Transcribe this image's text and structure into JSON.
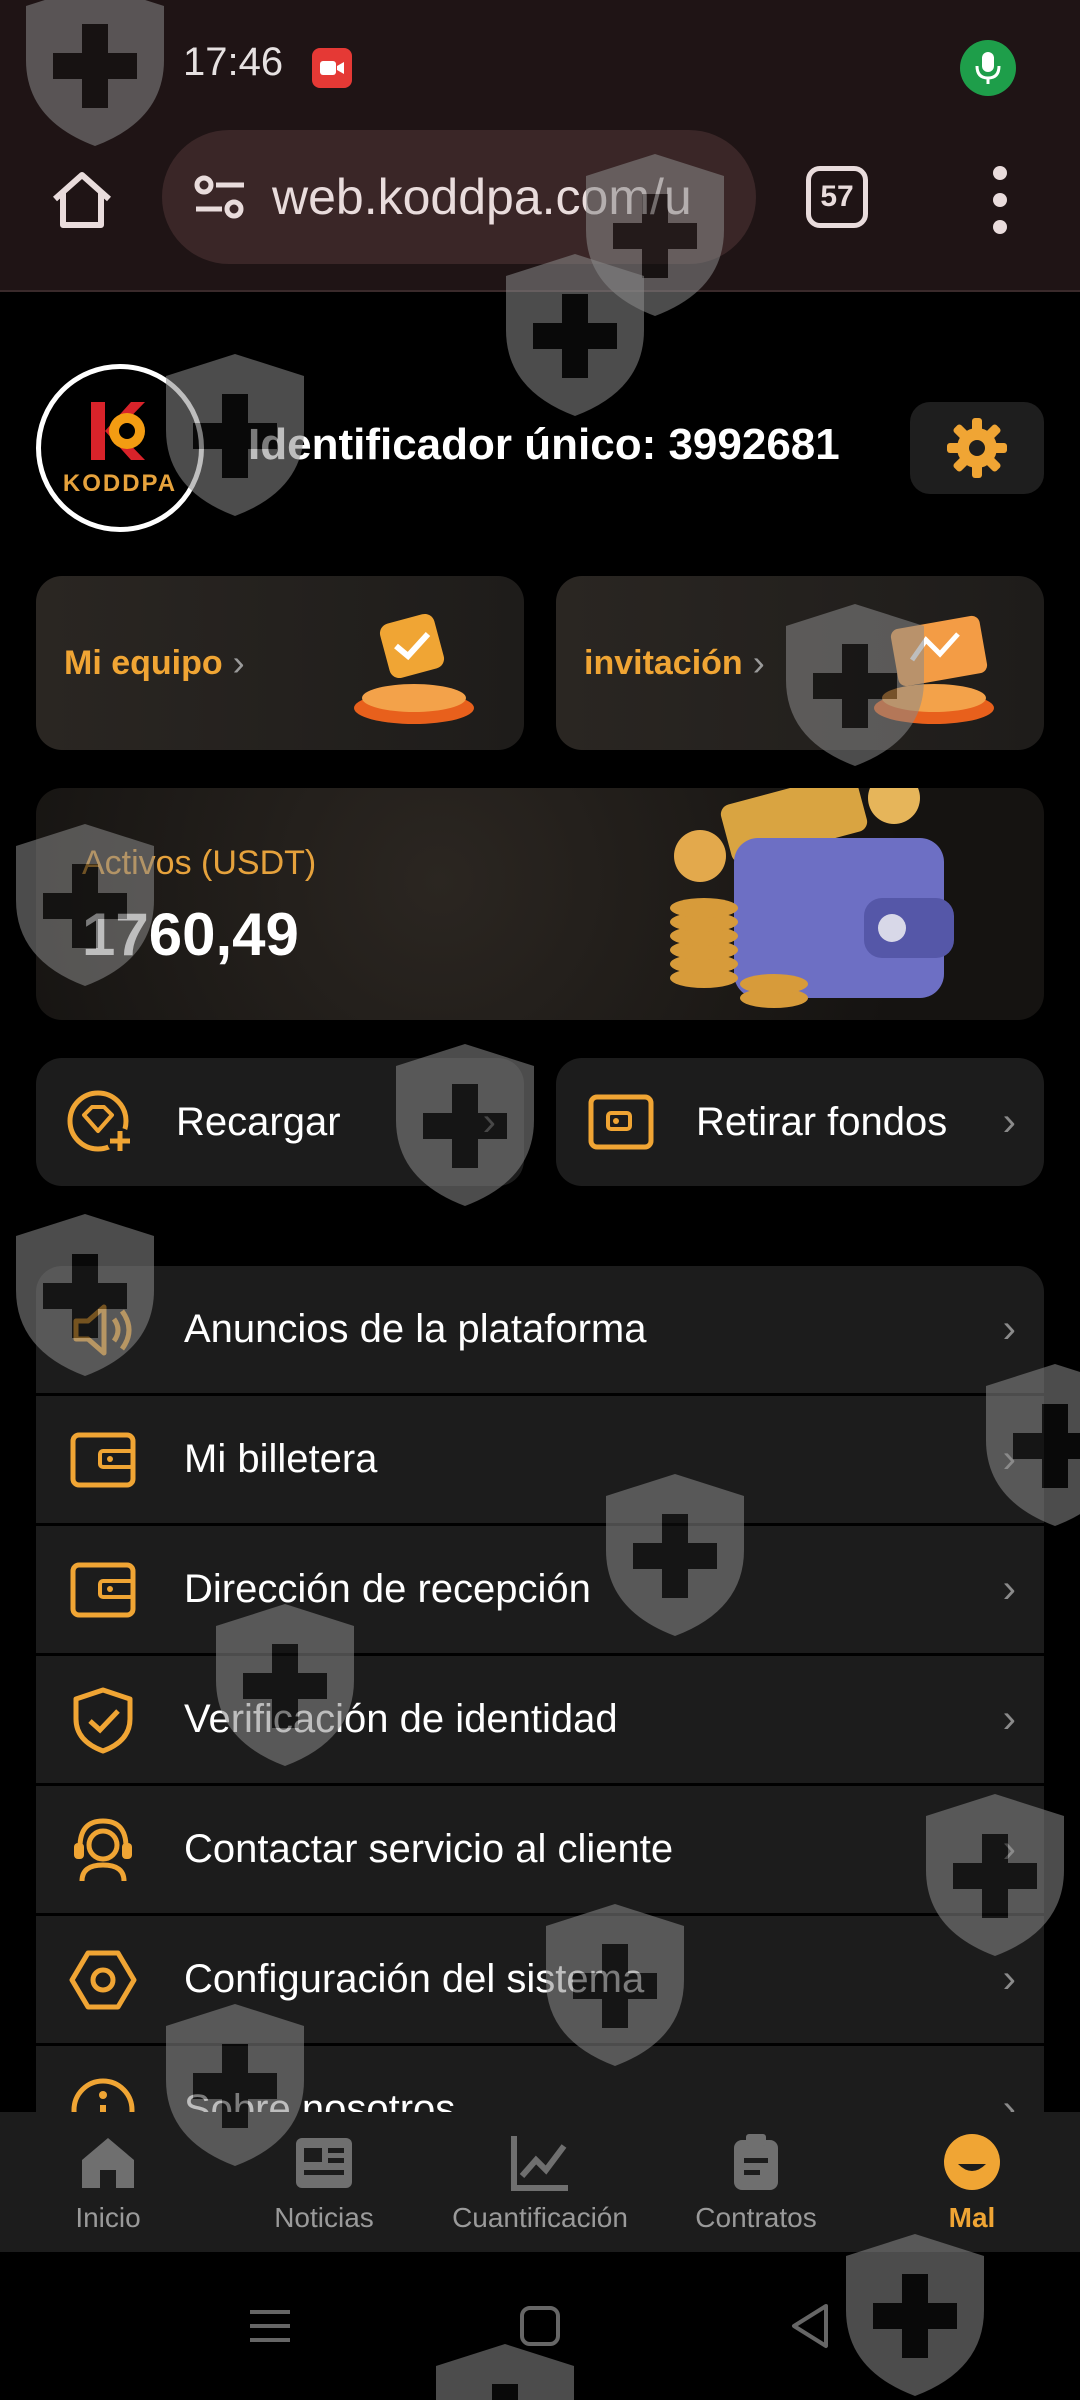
{
  "status_bar": {
    "time": "17:46"
  },
  "browser": {
    "url": "web.koddpa.com/u",
    "tab_count": "57"
  },
  "profile": {
    "avatar_brand": "KODDPA",
    "uid_text": "Identificador único: 3992681"
  },
  "quick_cards": [
    {
      "label": "Mi equipo"
    },
    {
      "label": "invitación"
    }
  ],
  "assets": {
    "label": "Activos (USDT)",
    "value": "1760,49"
  },
  "actions": [
    {
      "label": "Recargar"
    },
    {
      "label": "Retirar fondos"
    }
  ],
  "menu": [
    {
      "label": "Anuncios de la plataforma",
      "icon": "speaker-icon"
    },
    {
      "label": "Mi billetera",
      "icon": "wallet-icon"
    },
    {
      "label": "Dirección de recepción",
      "icon": "wallet-icon"
    },
    {
      "label": "Verificación de identidad",
      "icon": "shield-check-icon"
    },
    {
      "label": "Contactar servicio al cliente",
      "icon": "headset-icon"
    },
    {
      "label": "Configuración del sistema",
      "icon": "hexagon-settings-icon"
    },
    {
      "label": "Sobre nosotros",
      "icon": "info-icon"
    }
  ],
  "bottom_nav": [
    {
      "label": "Inicio",
      "icon": "home-icon"
    },
    {
      "label": "Noticias",
      "icon": "news-icon"
    },
    {
      "label": "Cuantificación",
      "icon": "chart-icon"
    },
    {
      "label": "Contratos",
      "icon": "clipboard-icon"
    },
    {
      "label": "Mal",
      "icon": "profile-face-icon",
      "active": true
    }
  ],
  "colors": {
    "accent": "#f0a534",
    "background": "#000000",
    "card": "#1c1c1c",
    "browser_chrome": "#1f1415"
  }
}
